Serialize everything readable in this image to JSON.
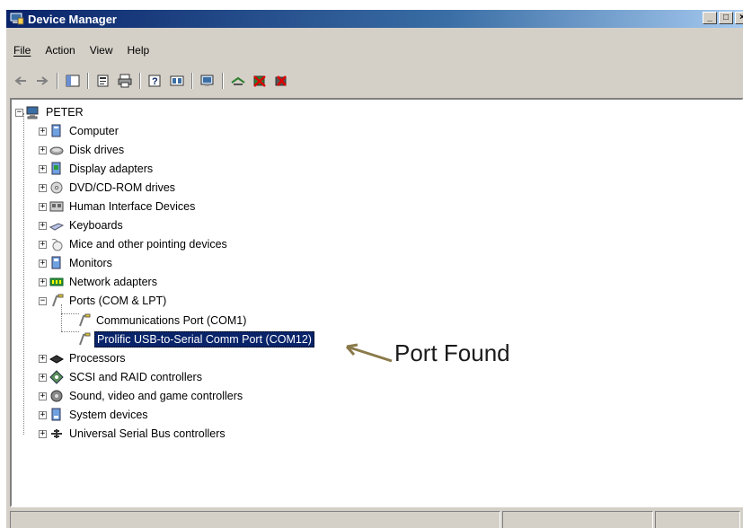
{
  "window": {
    "title": "Device Manager",
    "controls": [
      "_",
      "□",
      "×"
    ]
  },
  "menu": [
    {
      "label": "File"
    },
    {
      "label": "Action"
    },
    {
      "label": "View"
    },
    {
      "label": "Help"
    }
  ],
  "tree": {
    "root": "PETER",
    "categories": [
      {
        "label": "Computer",
        "icon": "computer-icon"
      },
      {
        "label": "Disk drives",
        "icon": "disk-drive-icon"
      },
      {
        "label": "Display adapters",
        "icon": "display-adapter-icon"
      },
      {
        "label": "DVD/CD-ROM drives",
        "icon": "dvd-drive-icon"
      },
      {
        "label": "Human Interface Devices",
        "icon": "hid-icon"
      },
      {
        "label": "Keyboards",
        "icon": "keyboard-icon"
      },
      {
        "label": "Mice and other pointing devices",
        "icon": "mouse-icon"
      },
      {
        "label": "Monitors",
        "icon": "monitor-icon"
      },
      {
        "label": "Network adapters",
        "icon": "network-adapter-icon"
      },
      {
        "label": "Ports (COM & LPT)",
        "icon": "port-icon"
      },
      {
        "label": "Processors",
        "icon": "processor-icon"
      },
      {
        "label": "SCSI and RAID controllers",
        "icon": "scsi-icon"
      },
      {
        "label": "Sound, video and game controllers",
        "icon": "sound-icon"
      },
      {
        "label": "System devices",
        "icon": "system-device-icon"
      },
      {
        "label": "Universal Serial Bus controllers",
        "icon": "usb-icon"
      }
    ],
    "ports_children": [
      {
        "label": "Communications Port (COM1)"
      },
      {
        "label": "Prolific USB-to-Serial Comm Port (COM12)",
        "selected": true
      }
    ]
  },
  "annotation": {
    "text": "Port Found"
  }
}
